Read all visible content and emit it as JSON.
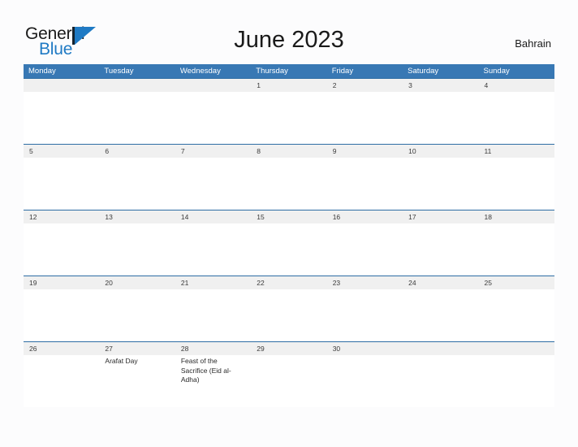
{
  "brand": {
    "line1": "General",
    "line2": "Blue",
    "mark_icon": "triangle-flag-icon",
    "color_dark": "#16232e",
    "color_blue": "#1f7ac4"
  },
  "header": {
    "title": "June 2023",
    "country": "Bahrain"
  },
  "colors": {
    "header_band": "#3878b4",
    "row_divider": "#2e6da4",
    "day_band": "#f0f0f0",
    "page_background": "#fcfcfd"
  },
  "calendar": {
    "weekdays": [
      "Monday",
      "Tuesday",
      "Wednesday",
      "Thursday",
      "Friday",
      "Saturday",
      "Sunday"
    ],
    "weeks": [
      {
        "days": [
          {
            "num": "",
            "event": ""
          },
          {
            "num": "",
            "event": ""
          },
          {
            "num": "",
            "event": ""
          },
          {
            "num": "1",
            "event": ""
          },
          {
            "num": "2",
            "event": ""
          },
          {
            "num": "3",
            "event": ""
          },
          {
            "num": "4",
            "event": ""
          }
        ]
      },
      {
        "days": [
          {
            "num": "5",
            "event": ""
          },
          {
            "num": "6",
            "event": ""
          },
          {
            "num": "7",
            "event": ""
          },
          {
            "num": "8",
            "event": ""
          },
          {
            "num": "9",
            "event": ""
          },
          {
            "num": "10",
            "event": ""
          },
          {
            "num": "11",
            "event": ""
          }
        ]
      },
      {
        "days": [
          {
            "num": "12",
            "event": ""
          },
          {
            "num": "13",
            "event": ""
          },
          {
            "num": "14",
            "event": ""
          },
          {
            "num": "15",
            "event": ""
          },
          {
            "num": "16",
            "event": ""
          },
          {
            "num": "17",
            "event": ""
          },
          {
            "num": "18",
            "event": ""
          }
        ]
      },
      {
        "days": [
          {
            "num": "19",
            "event": ""
          },
          {
            "num": "20",
            "event": ""
          },
          {
            "num": "21",
            "event": ""
          },
          {
            "num": "22",
            "event": ""
          },
          {
            "num": "23",
            "event": ""
          },
          {
            "num": "24",
            "event": ""
          },
          {
            "num": "25",
            "event": ""
          }
        ]
      },
      {
        "days": [
          {
            "num": "26",
            "event": ""
          },
          {
            "num": "27",
            "event": "Arafat Day"
          },
          {
            "num": "28",
            "event": "Feast of the Sacrifice (Eid al-Adha)"
          },
          {
            "num": "29",
            "event": ""
          },
          {
            "num": "30",
            "event": ""
          },
          {
            "num": "",
            "event": ""
          },
          {
            "num": "",
            "event": ""
          }
        ]
      }
    ]
  }
}
